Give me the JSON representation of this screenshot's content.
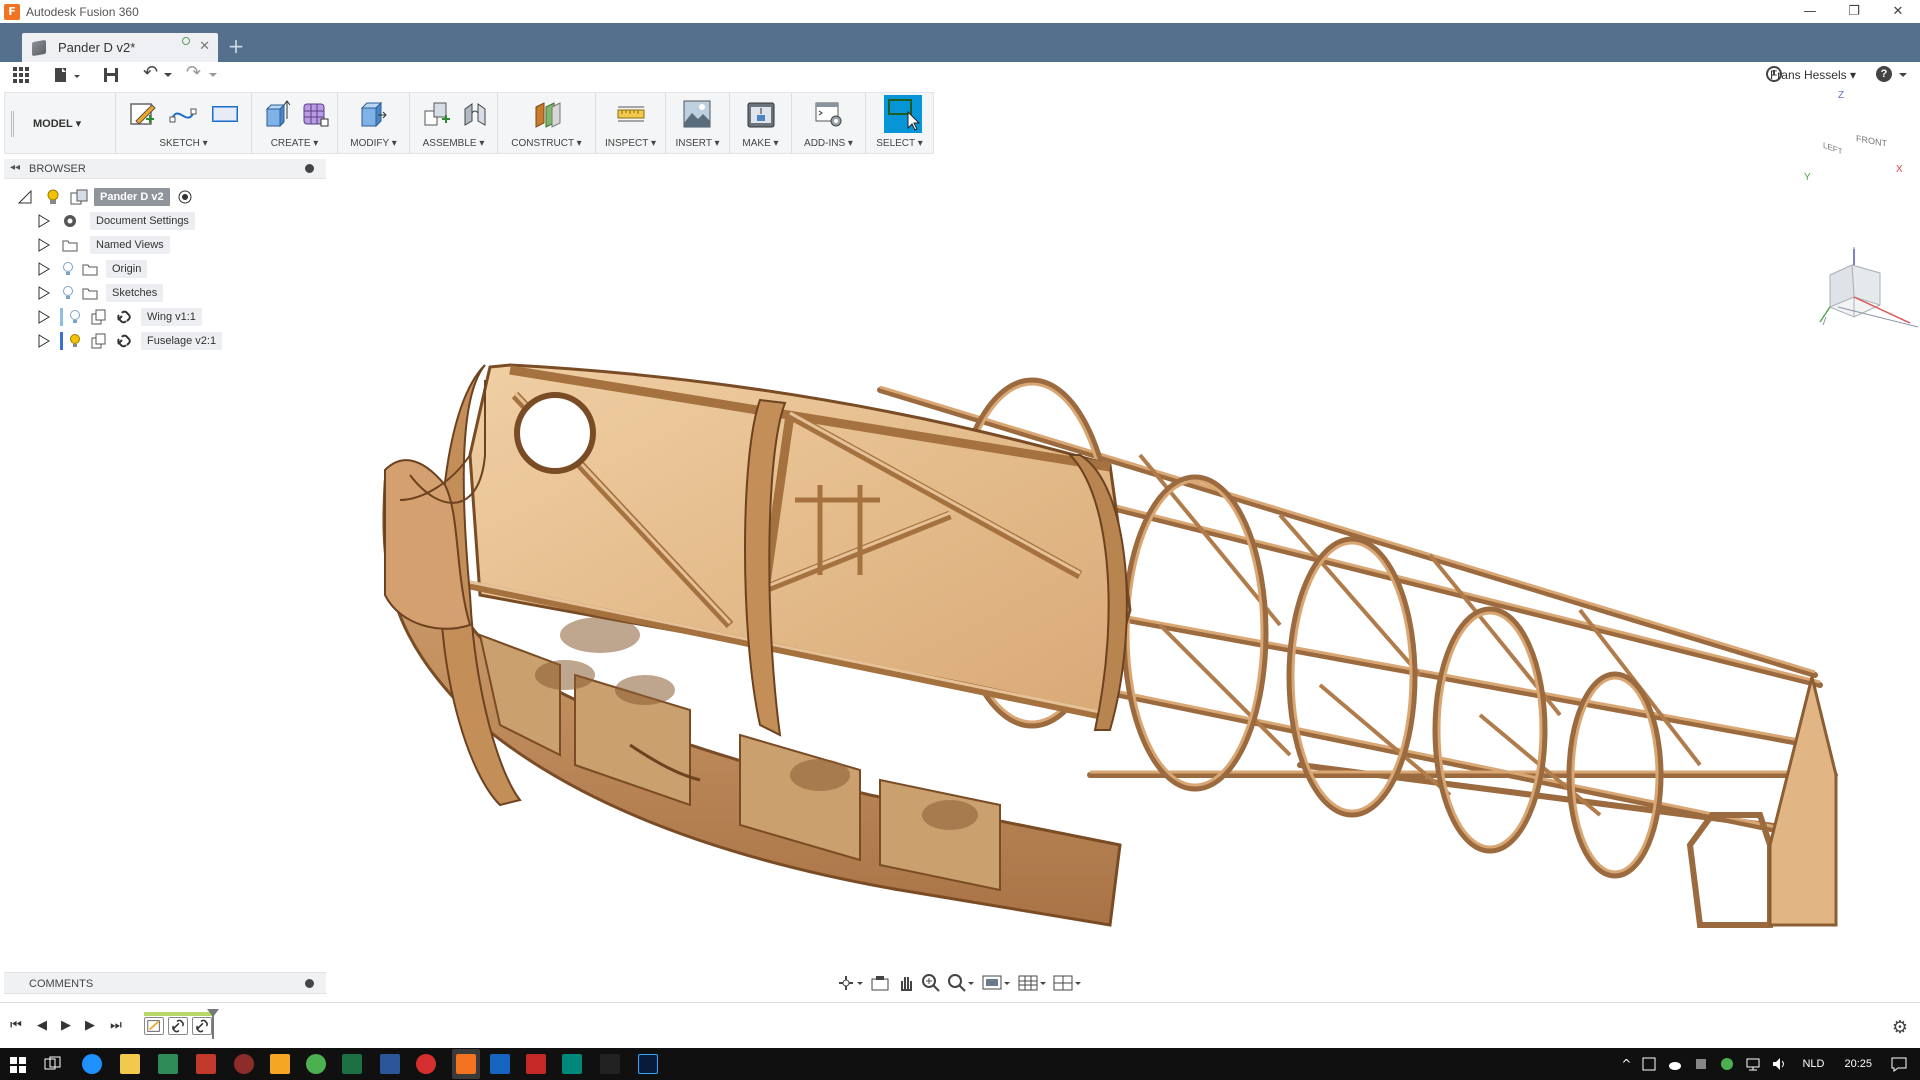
{
  "window": {
    "app_title": "Autodesk Fusion 360",
    "logo_letter": "F",
    "minimize": "—",
    "restore": "❐",
    "close": "✕"
  },
  "tabs": {
    "document": "Pander D v2*",
    "close": "✕",
    "new_tab": "+"
  },
  "quickbar": {
    "user": "Frans Hessels",
    "user_caret": "▾",
    "help": "?",
    "undo": "↶",
    "redo": "↷"
  },
  "ribbon": {
    "workspace": "MODEL ▾",
    "groups": [
      {
        "label": "SKETCH ▾"
      },
      {
        "label": "CREATE ▾"
      },
      {
        "label": "MODIFY ▾"
      },
      {
        "label": "ASSEMBLE ▾"
      },
      {
        "label": "CONSTRUCT ▾"
      },
      {
        "label": "INSPECT ▾"
      },
      {
        "label": "INSERT ▾"
      },
      {
        "label": "MAKE ▾"
      },
      {
        "label": "ADD-INS ▾"
      },
      {
        "label": "SELECT ▾"
      }
    ]
  },
  "browser": {
    "title": "BROWSER",
    "collapse": "◂◂",
    "root": "Pander D v2",
    "items": [
      {
        "label": "Document Settings"
      },
      {
        "label": "Named Views"
      },
      {
        "label": "Origin"
      },
      {
        "label": "Sketches"
      },
      {
        "label": "Wing v1:1"
      },
      {
        "label": "Fuselage v2:1"
      }
    ]
  },
  "viewcube": {
    "left": "LEFT",
    "front": "FRONT",
    "z": "Z",
    "x": "X",
    "y": "Y"
  },
  "comments": {
    "title": "COMMENTS"
  },
  "navbar": {
    "icons": [
      "orbit-icon",
      "look-at-icon",
      "pan-icon",
      "zoom-icon",
      "fit-icon",
      "display-settings-icon",
      "grid-icon",
      "viewports-icon"
    ]
  },
  "timeline": {
    "first": "⏮",
    "prev": "◀",
    "play": "▶",
    "next": "▶",
    "last": "⏭",
    "settings": "⚙"
  },
  "taskbar": {
    "lang": "NLD",
    "time": "20:25",
    "tray_up": "^"
  },
  "colors": {
    "accent": "#0696d7",
    "tabbar": "#54708c",
    "wood_light": "#e7c296",
    "wood_mid": "#d4a373",
    "wood_dark": "#a8754a",
    "lightbulb": "#f2c200"
  }
}
